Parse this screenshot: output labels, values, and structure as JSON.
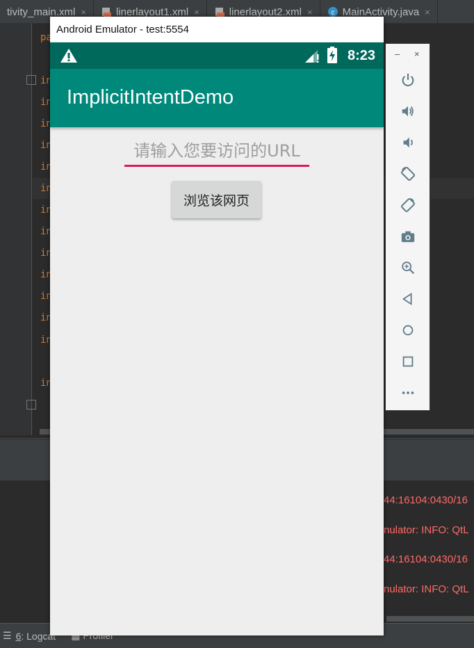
{
  "ide": {
    "tabs": [
      {
        "label": "tivity_main.xml",
        "icon": "xml-file-icon"
      },
      {
        "label": "linerlayout1.xml",
        "icon": "xml-file-icon"
      },
      {
        "label": "linerlayout2.xml",
        "icon": "xml-file-icon"
      },
      {
        "label": "MainActivity.java",
        "icon": "java-class-icon"
      }
    ],
    "code_lines": [
      "pa",
      "in",
      "in",
      "in",
      "in",
      "in",
      "in",
      "in",
      "in",
      "in",
      "in",
      "in",
      "in",
      "in",
      "in"
    ],
    "log_lines": [
      "44:16104:0430/16",
      "nulator: INFO: QtL",
      "44:16104:0430/16",
      "nulator: INFO: QtL"
    ],
    "status": {
      "logcat_num": "6",
      "logcat_label": ": Logcat",
      "profiler_label": "Profiler"
    }
  },
  "emulator": {
    "window_title": "Android Emulator - test:5554",
    "clock": "8:23",
    "app_title": "ImplicitIntentDemo",
    "url_placeholder": "请输入您要访问的URL",
    "browse_button": "浏览该网页",
    "colors": {
      "status_bar": "#00695c",
      "app_bar": "#00897b",
      "accent": "#d81b60"
    }
  },
  "controls": {
    "minimize": "–",
    "close": "×",
    "buttons": [
      "power-icon",
      "volume-up-icon",
      "volume-down-icon",
      "rotate-left-icon",
      "rotate-right-icon",
      "camera-icon",
      "zoom-icon",
      "back-icon",
      "home-icon",
      "overview-icon",
      "more-icon"
    ]
  }
}
